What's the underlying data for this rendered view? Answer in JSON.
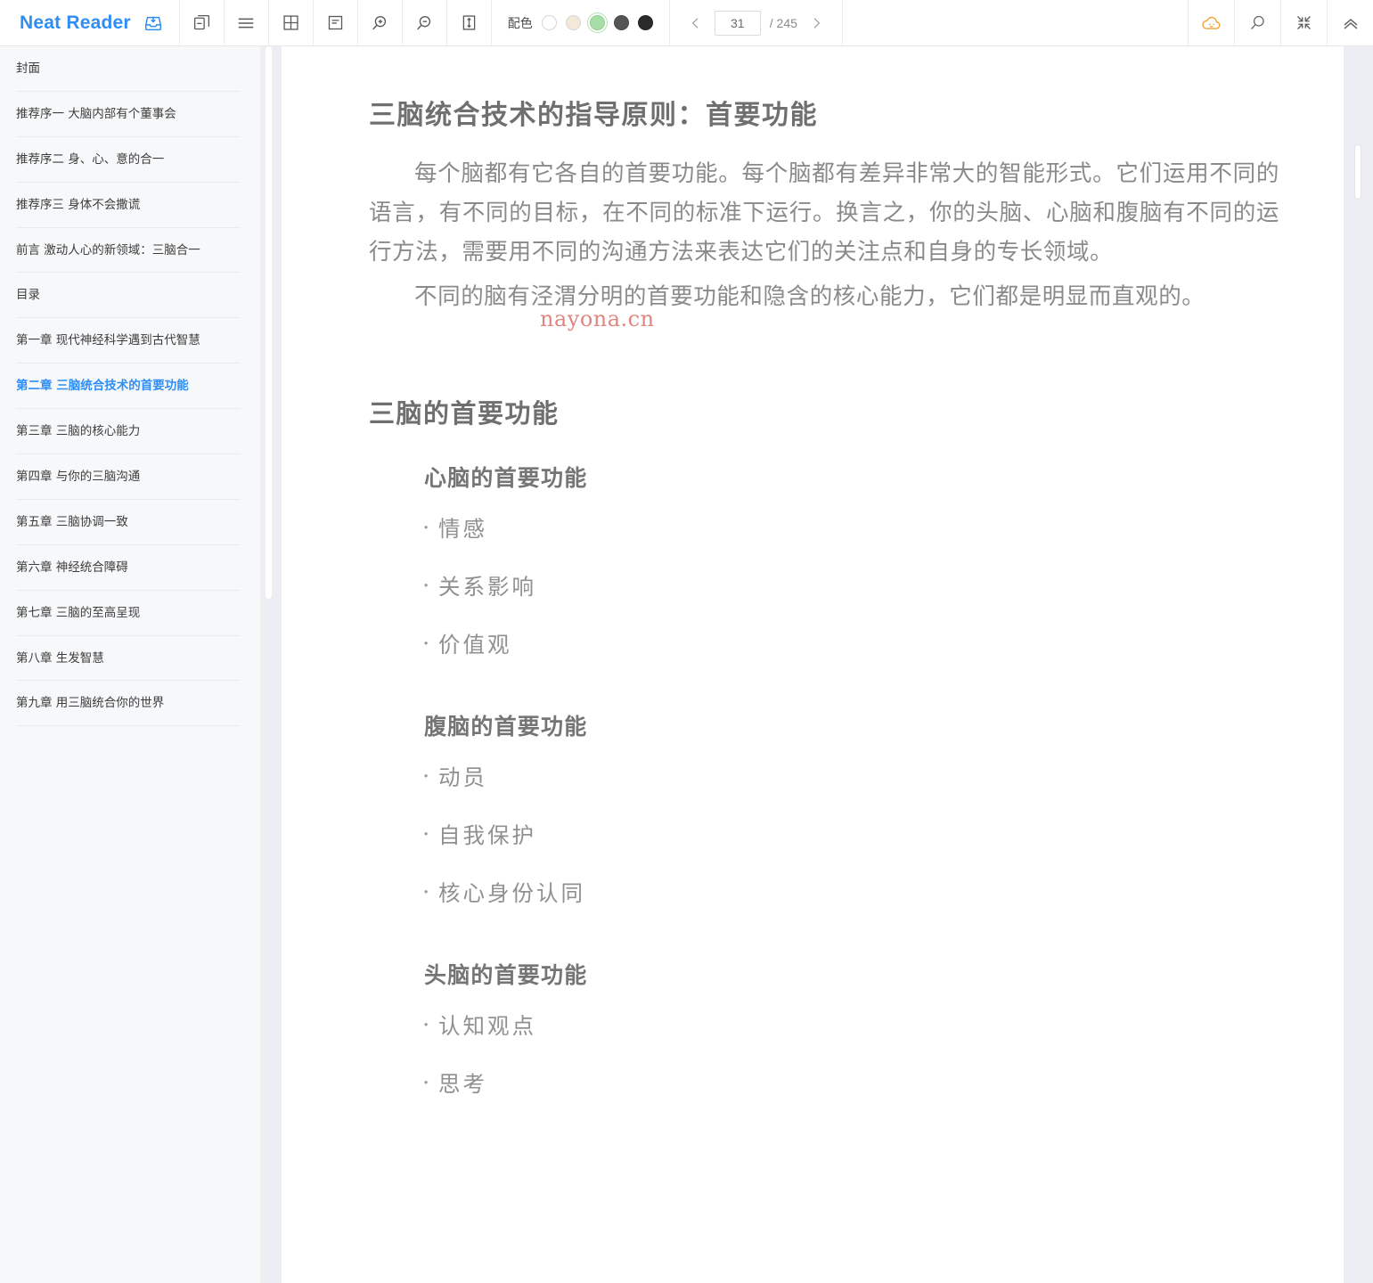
{
  "app": {
    "brand": "Neat Reader"
  },
  "toolbar": {
    "icons": {
      "save_to_shelf": "save-to-shelf-icon",
      "bookshelf": "bookshelf-icon",
      "toc": "toc-menu-icon",
      "grid_view": "grid-view-icon",
      "notes": "notes-icon",
      "zoom_in": "zoom-in-icon",
      "zoom_out": "zoom-out-icon",
      "line_height": "line-height-icon",
      "cloud_sync": "cloud-sync-icon",
      "search": "search-icon",
      "fullscreen_exit": "fullscreen-exit-icon",
      "collapse_toolbar": "chevron-up-icon"
    },
    "theme": {
      "label": "配色",
      "swatches": [
        {
          "name": "white",
          "color": "#ffffff",
          "selected": false
        },
        {
          "name": "sepia",
          "color": "#f4e8d8",
          "selected": false
        },
        {
          "name": "green",
          "color": "#a7dda7",
          "selected": true
        },
        {
          "name": "gray",
          "color": "#555555",
          "selected": false
        },
        {
          "name": "black",
          "color": "#2b2b2b",
          "selected": false
        }
      ]
    },
    "pager": {
      "prev_label": "‹",
      "next_label": "›",
      "current_page": "31",
      "separator": "/ 245",
      "total_pages": "245"
    }
  },
  "sidebar": {
    "items": [
      {
        "label": "封面",
        "active": false
      },
      {
        "label": "推荐序一 大脑内部有个董事会",
        "active": false
      },
      {
        "label": "推荐序二 身、心、意的合一",
        "active": false
      },
      {
        "label": "推荐序三 身体不会撒谎",
        "active": false
      },
      {
        "label": "前言 激动人心的新领域：三脑合一",
        "active": false
      },
      {
        "label": "目录",
        "active": false
      },
      {
        "label": "第一章 现代神经科学遇到古代智慧",
        "active": false
      },
      {
        "label": "第二章 三脑统合技术的首要功能",
        "active": true
      },
      {
        "label": "第三章 三脑的核心能力",
        "active": false
      },
      {
        "label": "第四章 与你的三脑沟通",
        "active": false
      },
      {
        "label": "第五章 三脑协调一致",
        "active": false
      },
      {
        "label": "第六章 神经统合障碍",
        "active": false
      },
      {
        "label": "第七章 三脑的至高呈现",
        "active": false
      },
      {
        "label": "第八章 生发智慧",
        "active": false
      },
      {
        "label": "第九章 用三脑统合你的世界",
        "active": false
      }
    ]
  },
  "content": {
    "heading": "三脑统合技术的指导原则：首要功能",
    "paragraphs": [
      "每个脑都有它各自的首要功能。每个脑都有差异非常大的智能形式。它们运用不同的语言，有不同的目标，在不同的标准下运行。换言之，你的头脑、心脑和腹脑有不同的运行方法，需要用不同的沟通方法来表达它们的关注点和自身的专长领域。",
      "不同的脑有泾渭分明的首要功能和隐含的核心能力，它们都是明显而直观的。"
    ],
    "section_heading": "三脑的首要功能",
    "groups": [
      {
        "subheading": "心脑的首要功能",
        "items": [
          "情感",
          "关系影响",
          "价值观"
        ]
      },
      {
        "subheading": "腹脑的首要功能",
        "items": [
          "动员",
          "自我保护",
          "核心身份认同"
        ]
      },
      {
        "subheading": "头脑的首要功能",
        "items": [
          "认知观点",
          "思考"
        ]
      }
    ],
    "watermark": "nayona.cn"
  },
  "colors": {
    "brand_blue": "#2f8ef4",
    "active_toc": "#2f8ef4",
    "watermark": "#e0857f",
    "sidebar_bg": "#f7f8fa",
    "cloud_icon": "#f5a623"
  }
}
